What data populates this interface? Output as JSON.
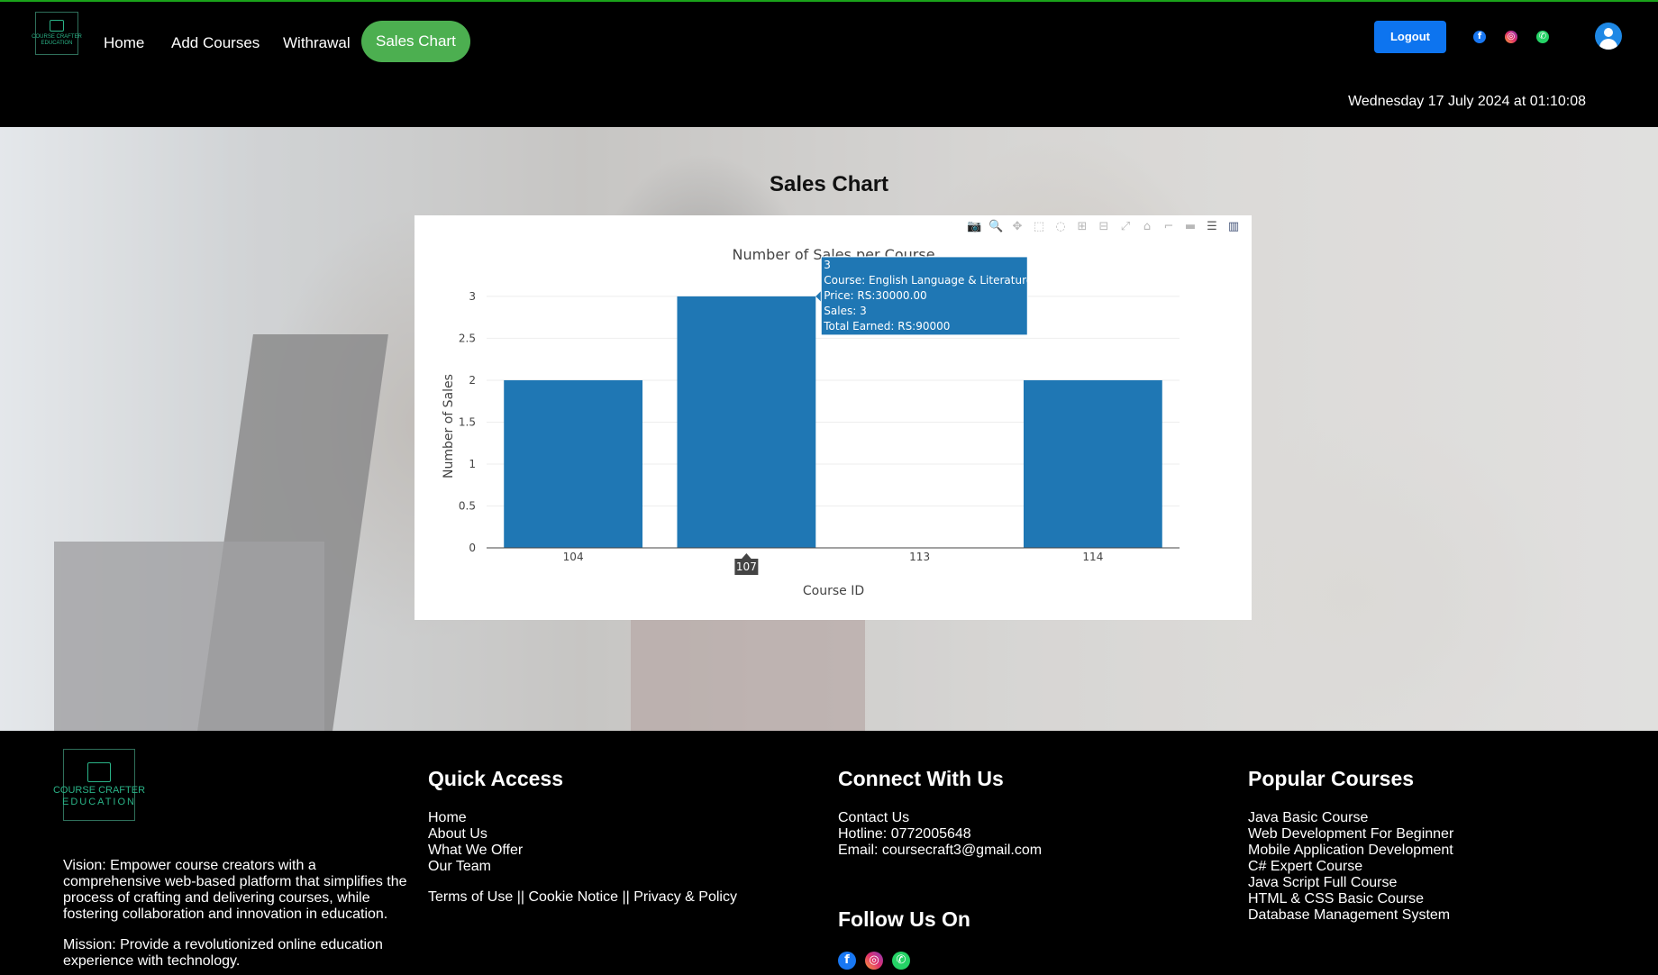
{
  "header": {
    "logo_line1": "COURSE CRAFTER",
    "logo_line2": "EDUCATION",
    "nav": [
      "Home",
      "Add Courses",
      "Withrawal",
      "Sales Chart"
    ],
    "active_nav": "Sales Chart",
    "logout_label": "Logout",
    "social_icons": [
      "facebook-icon",
      "instagram-icon",
      "whatsapp-icon"
    ],
    "datetime": "Wednesday 17 July 2024 at 01:10:08"
  },
  "page_title": "Sales Chart",
  "chart_data": {
    "type": "bar",
    "title": "Number of Sales per Course",
    "xlabel": "Course ID",
    "ylabel": "Number of Sales",
    "categories": [
      "104",
      "107",
      "113",
      "114"
    ],
    "values": [
      2,
      3,
      0,
      2
    ],
    "yticks": [
      "0",
      "0.5",
      "1",
      "1.5",
      "2",
      "2.5",
      "3"
    ],
    "ylim": [
      0,
      3.3
    ],
    "bar_color": "#1f77b4",
    "grid": true,
    "hover": {
      "category": "107",
      "lines": [
        "3",
        "Course: English Language & Literature",
        "Price: RS:30000.00",
        "Sales: 3",
        "Total Earned: RS:90000"
      ]
    }
  },
  "footer": {
    "logo_line1": "COURSE CRAFTER",
    "logo_line2": "EDUCATION",
    "vision": "Vision: Empower course creators with a comprehensive web-based platform that simplifies the process of crafting and delivering courses, while fostering collaboration and innovation in education.",
    "mission": "Mission: Provide a revolutionized online education experience with technology.",
    "quick_access_title": "Quick Access",
    "quick_links": [
      "Home",
      "About Us",
      "What We Offer",
      "Our Team"
    ],
    "legal": "Terms of Use || Cookie Notice || Privacy & Policy",
    "connect_title": "Connect With Us",
    "connect_lines": [
      "Contact Us",
      "Hotline: 0772005648",
      "Email: coursecraft3@gmail.com"
    ],
    "follow_title": "Follow Us On",
    "popular_title": "Popular Courses",
    "popular_courses": [
      "Java Basic Course",
      "Web Development For Beginner",
      "Mobile Application Development",
      "C# Expert Course",
      "Java Script Full Course",
      "HTML & CSS Basic Course",
      "Database Management System"
    ]
  },
  "colors": {
    "active_nav": "#4caf50",
    "logout": "#0d74ef",
    "bar": "#1f77b4"
  }
}
